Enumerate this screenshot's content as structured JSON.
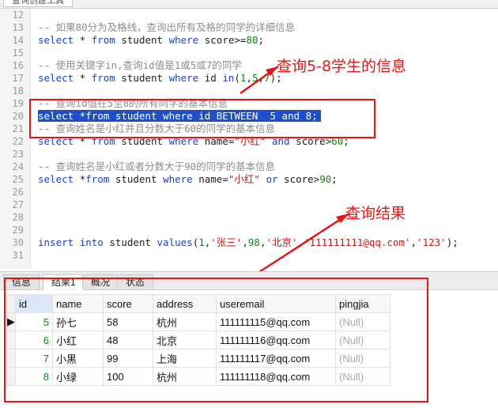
{
  "top_tab": "查询创建工具",
  "editor": {
    "lines": [
      {
        "n": "12",
        "parts": []
      },
      {
        "n": "13",
        "parts": [
          {
            "c": "cm",
            "t": "-- 如果80分为及格线，查询出所有及格的同学的详细信息"
          }
        ]
      },
      {
        "n": "14",
        "parts": [
          {
            "c": "kw",
            "t": "select"
          },
          {
            "c": "",
            "t": " * "
          },
          {
            "c": "kw",
            "t": "from"
          },
          {
            "c": "",
            "t": " student "
          },
          {
            "c": "kw",
            "t": "where"
          },
          {
            "c": "",
            "t": " score>="
          },
          {
            "c": "num",
            "t": "80"
          },
          {
            "c": "",
            "t": ";"
          }
        ]
      },
      {
        "n": "15",
        "parts": []
      },
      {
        "n": "16",
        "parts": [
          {
            "c": "cm",
            "t": "-- 使用关键字in,查询id值是1或5或7的同学"
          }
        ]
      },
      {
        "n": "17",
        "parts": [
          {
            "c": "kw",
            "t": "select"
          },
          {
            "c": "",
            "t": " * "
          },
          {
            "c": "kw",
            "t": "from"
          },
          {
            "c": "",
            "t": " student "
          },
          {
            "c": "kw",
            "t": "where"
          },
          {
            "c": "",
            "t": " id "
          },
          {
            "c": "kw",
            "t": "in"
          },
          {
            "c": "",
            "t": "("
          },
          {
            "c": "num",
            "t": "1"
          },
          {
            "c": "",
            "t": ","
          },
          {
            "c": "num",
            "t": "5"
          },
          {
            "c": "",
            "t": ","
          },
          {
            "c": "num",
            "t": "7"
          },
          {
            "c": "",
            "t": ");"
          }
        ]
      },
      {
        "n": "18",
        "parts": []
      },
      {
        "n": "19",
        "parts": [
          {
            "c": "cm",
            "t": "-- 查询id值在5至8的所有同学的基本信息"
          }
        ]
      },
      {
        "n": "20",
        "parts": [
          {
            "c": "sel",
            "t": "select *from student where id BETWEEN  5 and 8;"
          }
        ]
      },
      {
        "n": "21",
        "parts": [
          {
            "c": "cm",
            "t": "-- 查询姓名是小红并且分数大于60的同学的基本信息"
          }
        ]
      },
      {
        "n": "22",
        "parts": [
          {
            "c": "kw",
            "t": "select"
          },
          {
            "c": "",
            "t": " * "
          },
          {
            "c": "kw",
            "t": "from"
          },
          {
            "c": "",
            "t": " student "
          },
          {
            "c": "kw",
            "t": "where"
          },
          {
            "c": "",
            "t": " name="
          },
          {
            "c": "str",
            "t": "\"小红\""
          },
          {
            "c": "",
            "t": " "
          },
          {
            "c": "kw",
            "t": "and"
          },
          {
            "c": "",
            "t": " score>"
          },
          {
            "c": "num",
            "t": "60"
          },
          {
            "c": "",
            "t": ";"
          }
        ]
      },
      {
        "n": "23",
        "parts": []
      },
      {
        "n": "24",
        "parts": [
          {
            "c": "cm",
            "t": "-- 查询姓名是小红或者分数大于90的同学的基本信息"
          }
        ]
      },
      {
        "n": "25",
        "parts": [
          {
            "c": "kw",
            "t": "select"
          },
          {
            "c": "",
            "t": " *"
          },
          {
            "c": "kw",
            "t": "from"
          },
          {
            "c": "",
            "t": " student "
          },
          {
            "c": "kw",
            "t": "where"
          },
          {
            "c": "",
            "t": " name="
          },
          {
            "c": "str",
            "t": "\"小红\""
          },
          {
            "c": "",
            "t": " "
          },
          {
            "c": "kw",
            "t": "or"
          },
          {
            "c": "",
            "t": " score>"
          },
          {
            "c": "num",
            "t": "90"
          },
          {
            "c": "",
            "t": ";"
          }
        ]
      },
      {
        "n": "26",
        "parts": []
      },
      {
        "n": "27",
        "parts": []
      },
      {
        "n": "28",
        "parts": []
      },
      {
        "n": "29",
        "parts": []
      },
      {
        "n": "30",
        "parts": [
          {
            "c": "kw",
            "t": "insert"
          },
          {
            "c": "",
            "t": " "
          },
          {
            "c": "kw",
            "t": "into"
          },
          {
            "c": "",
            "t": " student "
          },
          {
            "c": "kw",
            "t": "values"
          },
          {
            "c": "",
            "t": "("
          },
          {
            "c": "num",
            "t": "1"
          },
          {
            "c": "",
            "t": ","
          },
          {
            "c": "str",
            "t": "'张三'"
          },
          {
            "c": "",
            "t": ","
          },
          {
            "c": "num",
            "t": "98"
          },
          {
            "c": "",
            "t": ","
          },
          {
            "c": "str",
            "t": "'北京'"
          },
          {
            "c": "",
            "t": ","
          },
          {
            "c": "str",
            "t": "'111111111@qq.com'"
          },
          {
            "c": "",
            "t": ","
          },
          {
            "c": "str",
            "t": "'123'"
          },
          {
            "c": "",
            "t": ");"
          }
        ]
      },
      {
        "n": "31",
        "parts": []
      }
    ]
  },
  "annotations": {
    "query_label": "查询5-8学生的信息",
    "result_label": "查询结果"
  },
  "result_tabs": [
    "信息",
    "结果1",
    "概况",
    "状态"
  ],
  "result_table": {
    "columns": [
      "id",
      "name",
      "score",
      "address",
      "useremail",
      "pingjia"
    ],
    "rows": [
      [
        "5",
        "孙七",
        "58",
        "杭州",
        "111111115@qq.com",
        "(Null)"
      ],
      [
        "6",
        "小红",
        "48",
        "北京",
        "111111116@qq.com",
        "(Null)"
      ],
      [
        "7",
        "小黑",
        "99",
        "上海",
        "111111117@qq.com",
        "(Null)"
      ],
      [
        "8",
        "小绿",
        "100",
        "杭州",
        "111111118@qq.com",
        "(Null)"
      ]
    ]
  },
  "colors": {
    "keyword": "#1c3fc4",
    "comment": "#8c8c8c",
    "string": "#c01818",
    "selection": "#1e4fc9",
    "annotation": "#e61414"
  }
}
